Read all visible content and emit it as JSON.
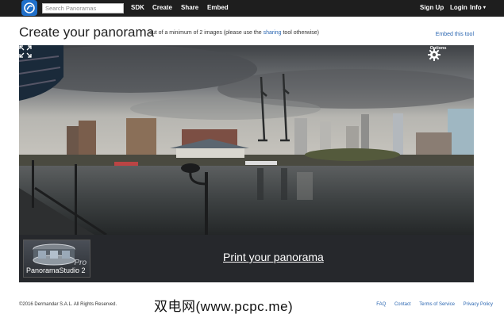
{
  "nav": {
    "search_placeholder": "Search Panoramas",
    "sdk": "SDK",
    "create": "Create",
    "share": "Share",
    "embed": "Embed",
    "sign_up": "Sign Up",
    "login": "Login",
    "info": "Info",
    "info_caret": "▾"
  },
  "header": {
    "title": "Create your panorama",
    "subtitle_before": "out of a minimum of 2 images (please use the ",
    "subtitle_link": "sharing",
    "subtitle_after": " tool otherwise)",
    "embed_tool": "Embed this tool"
  },
  "viewer": {
    "options_label": "Options",
    "options_icon": "gear-icon",
    "fullscreen_icon": "expand-icon"
  },
  "banner": {
    "product_name": "PanoramaStudio 2",
    "product_badge": "Pro",
    "print_link": "Print your panorama"
  },
  "footer": {
    "copyright": "©2016 Dermandar S.A.L. All Rights Reserved.",
    "links": [
      "FAQ",
      "Contact",
      "Terms of Service",
      "Privacy Policy"
    ]
  },
  "watermark": "双电网(www.pcpc.me)",
  "colors": {
    "topbar": "#1e1e1e",
    "link": "#2a66b1",
    "banner": "#26282c",
    "logo": "#1f6fc9"
  }
}
